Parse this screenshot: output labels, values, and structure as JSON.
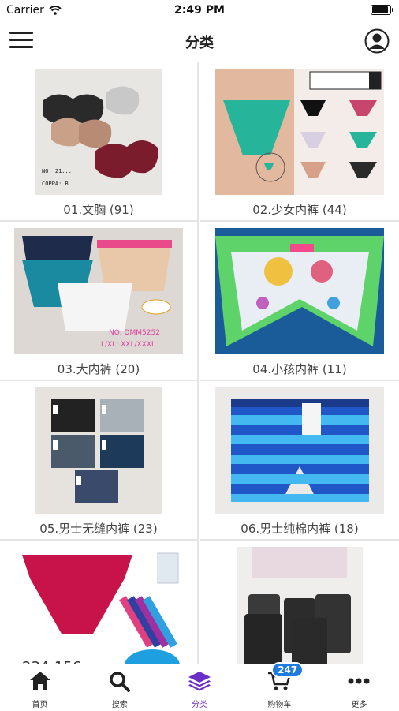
{
  "status_bar": {
    "carrier": "Carrier",
    "time": "2:49 PM"
  },
  "nav": {
    "title": "分类"
  },
  "categories": [
    {
      "label": "01.文胸 (91)"
    },
    {
      "label": "02.少女内裤 (44)"
    },
    {
      "label": "03.大内裤 (20)"
    },
    {
      "label": "04.小孩内裤 (11)"
    },
    {
      "label": "05.男士无缝内裤 (23)"
    },
    {
      "label": "06.男士纯棉内裤 (18)"
    },
    {
      "label": ""
    },
    {
      "label": ""
    }
  ],
  "tabs": [
    {
      "label": "首页",
      "icon": "home-icon"
    },
    {
      "label": "搜索",
      "icon": "search-icon"
    },
    {
      "label": "分类",
      "icon": "layers-icon"
    },
    {
      "label": "购物车",
      "icon": "cart-icon",
      "badge": "247"
    },
    {
      "label": "更多",
      "icon": "more-icon"
    }
  ],
  "colors": {
    "active_tab": "#6b2fc7",
    "badge": "#1e7be0"
  }
}
